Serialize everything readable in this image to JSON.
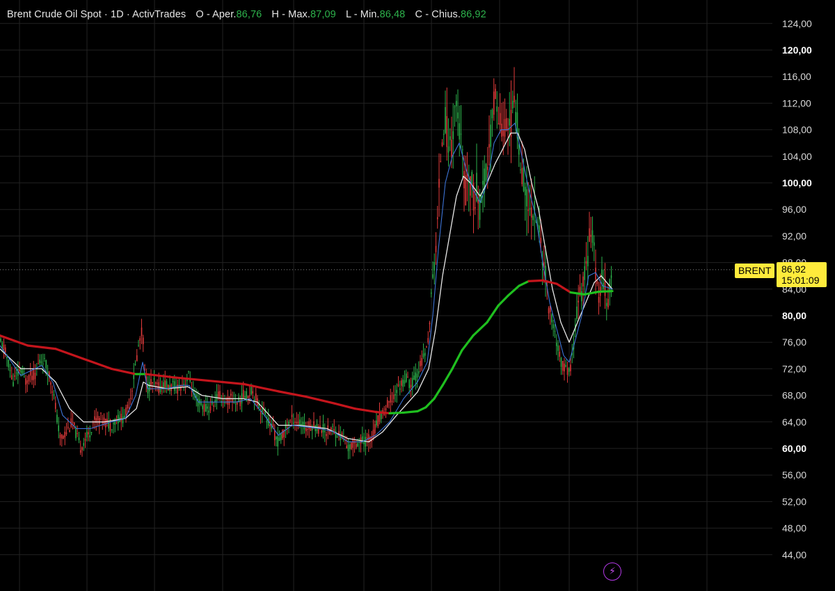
{
  "header": {
    "instrument": "Brent Crude Oil Spot · 1D · ActivTrades",
    "open_label": "O - Aper.",
    "open": "86,76",
    "high_label": "H - Max.",
    "high": "87,09",
    "low_label": "L - Min.",
    "low": "86,48",
    "close_label": "C - Chius.",
    "close": "86,92"
  },
  "price_badge": {
    "symbol": "BRENT",
    "price": "86,92",
    "countdown": "15:01:09"
  },
  "colors": {
    "up": "#2db14b",
    "down": "#e03a3a",
    "ma_fast": "#3d74d6",
    "ma_slow": "#e8e8e8",
    "ma_long_down": "#c4151c",
    "ma_long_up": "#1fbf1f",
    "badge": "#ffeb3b"
  },
  "icons": [
    "lightning-icon"
  ],
  "chart_data": {
    "type": "candlestick",
    "title": "Brent Crude Oil Spot · 1D · ActivTrades",
    "y_axis": {
      "min": 42,
      "max": 125,
      "position": "right",
      "ticks": [
        "124,00",
        "120,00",
        "116,00",
        "112,00",
        "108,00",
        "104,00",
        "100,00",
        "96,00",
        "92,00",
        "88,00",
        "84,00",
        "80,00",
        "76,00",
        "72,00",
        "68,00",
        "64,00",
        "60,00",
        "56,00",
        "52,00",
        "48,00",
        "44,00"
      ],
      "major_ticks": [
        "120,00",
        "100,00",
        "80,00",
        "60,00"
      ]
    },
    "grid": true,
    "last_price": 86.92,
    "price_path": [
      [
        0,
        76
      ],
      [
        6,
        75
      ],
      [
        12,
        73
      ],
      [
        18,
        70
      ],
      [
        24,
        71
      ],
      [
        30,
        72
      ],
      [
        36,
        70
      ],
      [
        42,
        71
      ],
      [
        50,
        71
      ],
      [
        56,
        73
      ],
      [
        62,
        73.5
      ],
      [
        68,
        72
      ],
      [
        74,
        70
      ],
      [
        80,
        66
      ],
      [
        86,
        61.5
      ],
      [
        92,
        62
      ],
      [
        98,
        63
      ],
      [
        104,
        64
      ],
      [
        110,
        62
      ],
      [
        116,
        60
      ],
      [
        122,
        61.5
      ],
      [
        128,
        62
      ],
      [
        134,
        64
      ],
      [
        140,
        64.5
      ],
      [
        146,
        64.5
      ],
      [
        152,
        64
      ],
      [
        158,
        63.5
      ],
      [
        164,
        64
      ],
      [
        170,
        64.5
      ],
      [
        176,
        64.5
      ],
      [
        182,
        65.5
      ],
      [
        188,
        68
      ],
      [
        194,
        72
      ],
      [
        200,
        76
      ],
      [
        205,
        78
      ],
      [
        208,
        72
      ],
      [
        212,
        69
      ],
      [
        218,
        70
      ],
      [
        224,
        69.5
      ],
      [
        230,
        69
      ],
      [
        236,
        70
      ],
      [
        242,
        69
      ],
      [
        248,
        69.5
      ],
      [
        254,
        69
      ],
      [
        260,
        69.5
      ],
      [
        266,
        70
      ],
      [
        272,
        71
      ],
      [
        278,
        68
      ],
      [
        284,
        67
      ],
      [
        290,
        66.5
      ],
      [
        296,
        66
      ],
      [
        302,
        66
      ],
      [
        308,
        67
      ],
      [
        314,
        68
      ],
      [
        320,
        67.5
      ],
      [
        326,
        67
      ],
      [
        332,
        67.5
      ],
      [
        338,
        67
      ],
      [
        344,
        67
      ],
      [
        350,
        68
      ],
      [
        356,
        68
      ],
      [
        362,
        69
      ],
      [
        368,
        67.5
      ],
      [
        374,
        66
      ],
      [
        380,
        65.5
      ],
      [
        386,
        64
      ],
      [
        392,
        63
      ],
      [
        398,
        61
      ],
      [
        404,
        61.5
      ],
      [
        410,
        63
      ],
      [
        416,
        64
      ],
      [
        422,
        64.5
      ],
      [
        428,
        64
      ],
      [
        434,
        63.5
      ],
      [
        440,
        63
      ],
      [
        446,
        63.5
      ],
      [
        452,
        63.5
      ],
      [
        458,
        63
      ],
      [
        464,
        63
      ],
      [
        470,
        62.5
      ],
      [
        476,
        63
      ],
      [
        482,
        62.5
      ],
      [
        488,
        62
      ],
      [
        494,
        61.5
      ],
      [
        500,
        60
      ],
      [
        506,
        60.5
      ],
      [
        512,
        61
      ],
      [
        518,
        61
      ],
      [
        524,
        61
      ],
      [
        530,
        61.5
      ],
      [
        536,
        62
      ],
      [
        542,
        64
      ],
      [
        548,
        65
      ],
      [
        554,
        66
      ],
      [
        560,
        67
      ],
      [
        566,
        68
      ],
      [
        572,
        69
      ],
      [
        578,
        70
      ],
      [
        584,
        70.5
      ],
      [
        590,
        69.5
      ],
      [
        596,
        70.5
      ],
      [
        602,
        72
      ],
      [
        608,
        73.5
      ],
      [
        614,
        75
      ],
      [
        618,
        80
      ],
      [
        622,
        85
      ],
      [
        626,
        90
      ],
      [
        630,
        96
      ],
      [
        634,
        106
      ],
      [
        638,
        110
      ],
      [
        642,
        108
      ],
      [
        646,
        105
      ],
      [
        650,
        107
      ],
      [
        654,
        112
      ],
      [
        658,
        110
      ],
      [
        662,
        106
      ],
      [
        666,
        102
      ],
      [
        670,
        98
      ],
      [
        674,
        101
      ],
      [
        678,
        100
      ],
      [
        682,
        96
      ],
      [
        686,
        100
      ],
      [
        690,
        96
      ],
      [
        694,
        98
      ],
      [
        698,
        101
      ],
      [
        702,
        104
      ],
      [
        706,
        108
      ],
      [
        710,
        112
      ],
      [
        714,
        114
      ],
      [
        716,
        108
      ],
      [
        720,
        110
      ],
      [
        724,
        107
      ],
      [
        728,
        110
      ],
      [
        732,
        108
      ],
      [
        736,
        110
      ],
      [
        740,
        112
      ],
      [
        744,
        108
      ],
      [
        748,
        104
      ],
      [
        752,
        101
      ],
      [
        756,
        98
      ],
      [
        760,
        95
      ],
      [
        764,
        97
      ],
      [
        768,
        96
      ],
      [
        772,
        94
      ],
      [
        776,
        92
      ],
      [
        780,
        89
      ],
      [
        784,
        86
      ],
      [
        788,
        82
      ],
      [
        792,
        80
      ],
      [
        796,
        78
      ],
      [
        800,
        76
      ],
      [
        804,
        74
      ],
      [
        808,
        72.5
      ],
      [
        812,
        72
      ],
      [
        816,
        71.5
      ],
      [
        820,
        72
      ],
      [
        824,
        75
      ],
      [
        828,
        80
      ],
      [
        832,
        82
      ],
      [
        836,
        84
      ],
      [
        840,
        86
      ],
      [
        844,
        88
      ],
      [
        848,
        94
      ],
      [
        852,
        92
      ],
      [
        856,
        86
      ],
      [
        860,
        83
      ],
      [
        864,
        85
      ],
      [
        868,
        86
      ],
      [
        872,
        82
      ],
      [
        876,
        84
      ],
      [
        880,
        86.9
      ]
    ],
    "ma_fast_path": [
      [
        0,
        75.5
      ],
      [
        30,
        71
      ],
      [
        60,
        72.5
      ],
      [
        76,
        70
      ],
      [
        90,
        65
      ],
      [
        110,
        63
      ],
      [
        130,
        63
      ],
      [
        160,
        64
      ],
      [
        180,
        64.5
      ],
      [
        195,
        68
      ],
      [
        205,
        73
      ],
      [
        212,
        69
      ],
      [
        240,
        69
      ],
      [
        260,
        69.5
      ],
      [
        272,
        69.5
      ],
      [
        285,
        67
      ],
      [
        310,
        67
      ],
      [
        340,
        67
      ],
      [
        360,
        67.5
      ],
      [
        380,
        65
      ],
      [
        400,
        62
      ],
      [
        420,
        63.5
      ],
      [
        460,
        63
      ],
      [
        480,
        62.5
      ],
      [
        500,
        61
      ],
      [
        520,
        61
      ],
      [
        540,
        62
      ],
      [
        560,
        64
      ],
      [
        580,
        67.5
      ],
      [
        600,
        70
      ],
      [
        614,
        73
      ],
      [
        622,
        80
      ],
      [
        630,
        90
      ],
      [
        640,
        100
      ],
      [
        650,
        104
      ],
      [
        660,
        106
      ],
      [
        670,
        102
      ],
      [
        680,
        99
      ],
      [
        690,
        97
      ],
      [
        700,
        100
      ],
      [
        710,
        106
      ],
      [
        720,
        108
      ],
      [
        730,
        108
      ],
      [
        740,
        109
      ],
      [
        750,
        104
      ],
      [
        760,
        99
      ],
      [
        770,
        95
      ],
      [
        780,
        88
      ],
      [
        790,
        82
      ],
      [
        800,
        78
      ],
      [
        810,
        74
      ],
      [
        818,
        73
      ],
      [
        826,
        76
      ],
      [
        836,
        80
      ],
      [
        846,
        86
      ],
      [
        856,
        86.5
      ],
      [
        866,
        84.5
      ],
      [
        880,
        84
      ]
    ],
    "ma_slow_path": [
      [
        0,
        75
      ],
      [
        30,
        72
      ],
      [
        60,
        72
      ],
      [
        80,
        70
      ],
      [
        100,
        66
      ],
      [
        120,
        64
      ],
      [
        150,
        64
      ],
      [
        180,
        64.5
      ],
      [
        196,
        66
      ],
      [
        206,
        70
      ],
      [
        214,
        69.5
      ],
      [
        240,
        69
      ],
      [
        270,
        69.3
      ],
      [
        290,
        68
      ],
      [
        320,
        67.5
      ],
      [
        350,
        67.5
      ],
      [
        370,
        67
      ],
      [
        400,
        63.5
      ],
      [
        430,
        63.5
      ],
      [
        470,
        63
      ],
      [
        500,
        61.5
      ],
      [
        530,
        61
      ],
      [
        550,
        62.5
      ],
      [
        570,
        65
      ],
      [
        600,
        68.5
      ],
      [
        616,
        72
      ],
      [
        626,
        78
      ],
      [
        636,
        86
      ],
      [
        646,
        92
      ],
      [
        656,
        98
      ],
      [
        666,
        101
      ],
      [
        676,
        100
      ],
      [
        690,
        98
      ],
      [
        700,
        100
      ],
      [
        712,
        103
      ],
      [
        722,
        105
      ],
      [
        734,
        107.5
      ],
      [
        744,
        107.5
      ],
      [
        754,
        105
      ],
      [
        764,
        100
      ],
      [
        774,
        96
      ],
      [
        784,
        90
      ],
      [
        794,
        84
      ],
      [
        806,
        79
      ],
      [
        818,
        76
      ],
      [
        830,
        79
      ],
      [
        842,
        82
      ],
      [
        854,
        85
      ],
      [
        864,
        86
      ],
      [
        880,
        84
      ]
    ],
    "ma_long_path": [
      [
        0,
        77
      ],
      [
        40,
        75.5
      ],
      [
        80,
        75
      ],
      [
        120,
        73.5
      ],
      [
        160,
        72
      ],
      [
        195,
        71.2
      ],
      [
        210,
        71.2
      ],
      [
        250,
        70.7
      ],
      [
        300,
        70.2
      ],
      [
        350,
        69.7
      ],
      [
        400,
        68.6
      ],
      [
        440,
        67.8
      ],
      [
        480,
        66.8
      ],
      [
        510,
        66
      ],
      [
        540,
        65.5
      ],
      [
        560,
        65.3
      ],
      [
        580,
        65.4
      ],
      [
        600,
        65.6
      ],
      [
        612,
        66.2
      ],
      [
        624,
        67.5
      ],
      [
        636,
        69.5
      ],
      [
        650,
        72
      ],
      [
        664,
        74.8
      ],
      [
        680,
        77
      ],
      [
        700,
        79
      ],
      [
        716,
        81.5
      ],
      [
        730,
        83
      ],
      [
        746,
        84.5
      ],
      [
        760,
        85.2
      ],
      [
        780,
        85.3
      ],
      [
        800,
        84.8
      ],
      [
        820,
        83.5
      ],
      [
        840,
        83.2
      ],
      [
        860,
        83.6
      ],
      [
        880,
        83.7
      ]
    ],
    "ma_long_green_ranges": [
      [
        188,
        210
      ],
      [
        560,
        760
      ],
      [
        828,
        880
      ]
    ]
  }
}
